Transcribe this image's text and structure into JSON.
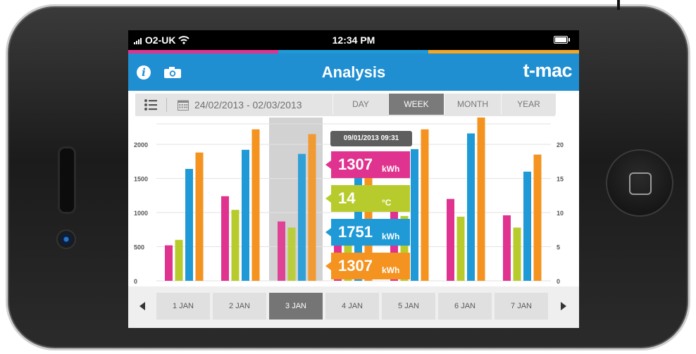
{
  "status": {
    "carrier": "O2-UK",
    "time": "12:34 PM"
  },
  "header": {
    "title": "Analysis",
    "logo": "t-mac"
  },
  "icons": {
    "info": "info-icon",
    "camera": "camera-icon",
    "list": "list-icon",
    "calendar": "calendar-icon",
    "signal": "signal-icon",
    "wifi": "wifi-icon",
    "battery": "battery-icon"
  },
  "toolbar": {
    "date_range": "24/02/2013 - 02/03/2013",
    "periods": [
      "DAY",
      "WEEK",
      "MONTH",
      "YEAR"
    ],
    "selected_period": "WEEK"
  },
  "colors": {
    "pink": "#e0338f",
    "green": "#b7cc2c",
    "blue": "#1f9ad7",
    "orange": "#f49320",
    "header": "#1f8fd2"
  },
  "chart_data": {
    "type": "bar",
    "categories": [
      "1 JAN",
      "2 JAN",
      "3 JAN",
      "4 JAN",
      "5 JAN",
      "6 JAN",
      "7 JAN"
    ],
    "y_left_ticks": [
      "0",
      "500",
      "1000",
      "1500",
      "2000"
    ],
    "y_right_ticks": [
      "0",
      "5",
      "10",
      "15",
      "20"
    ],
    "ylim_left": [
      0,
      2300
    ],
    "ylim_right": [
      0,
      23
    ],
    "series": [
      {
        "values": [
          520,
          1240,
          870,
          520,
          1150,
          1200,
          960
        ]
      },
      {
        "values": [
          600,
          1040,
          780,
          770,
          950,
          940,
          780
        ]
      },
      {
        "values": [
          1640,
          1920,
          1860,
          1620,
          1930,
          2160,
          1600
        ]
      },
      {
        "values": [
          1880,
          2220,
          2150,
          1790,
          2220,
          2530,
          1850
        ]
      }
    ],
    "highlight_index": 2
  },
  "tooltip": {
    "timestamp": "09/01/2013 09:31",
    "items": [
      {
        "value": "1307",
        "unit": "kWh"
      },
      {
        "value": "14",
        "unit": "°C"
      },
      {
        "value": "1751",
        "unit": "kWh"
      },
      {
        "value": "1307",
        "unit": "kWh"
      }
    ]
  },
  "days": {
    "labels": [
      "1 JAN",
      "2 JAN",
      "3 JAN",
      "4 JAN",
      "5 JAN",
      "6 JAN",
      "7 JAN"
    ],
    "selected": "3 JAN"
  }
}
